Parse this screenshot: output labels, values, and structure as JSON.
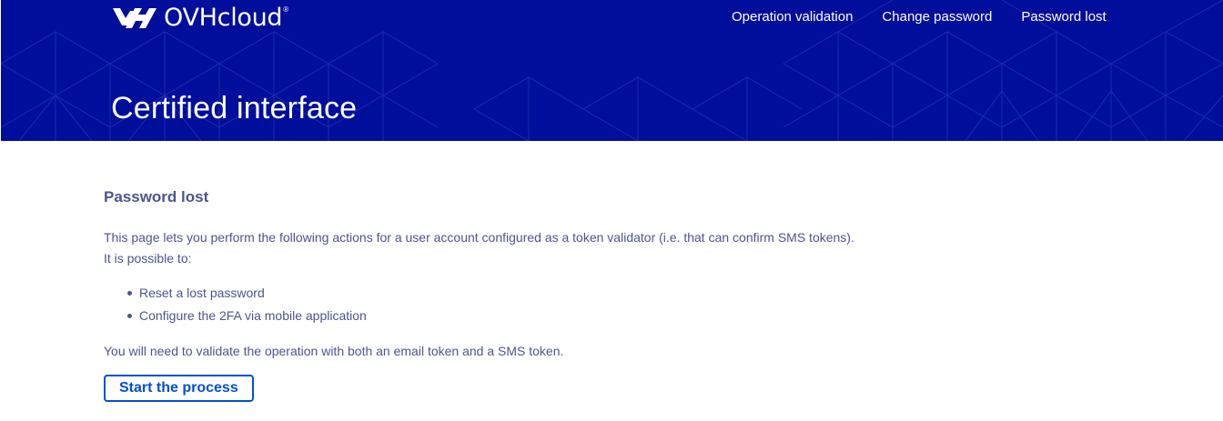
{
  "header": {
    "logo_text": "OVHcloud",
    "logo_registered": "®",
    "nav": [
      {
        "label": "Operation validation"
      },
      {
        "label": "Change password"
      },
      {
        "label": "Password lost"
      }
    ],
    "title": "Certified interface"
  },
  "main": {
    "section_title": "Password lost",
    "intro_line1": "This page lets you perform the following actions for a user account configured as a token validator (i.e. that can confirm SMS tokens).",
    "intro_line2": "It is possible to:",
    "features": [
      "Reset a lost password",
      "Configure the 2FA via mobile application"
    ],
    "note": "You will need to validate the operation with both an email token and a SMS token.",
    "start_button": "Start the process"
  },
  "colors": {
    "header_bg": "#000e9c",
    "text": "#4d5592",
    "accent": "#0050d7",
    "white": "#ffffff"
  },
  "icons": {
    "logo": "ovhcloud-logo-icon",
    "bullet": "bullet-dot-icon"
  }
}
